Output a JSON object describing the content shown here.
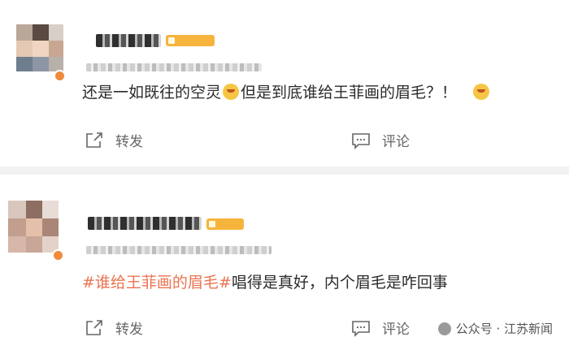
{
  "posts": [
    {
      "text_before_emoji": "还是一如既往的空灵",
      "text_after_emoji": "但是到底谁给王菲画的眉毛？！",
      "emoji_1": "smile-emoji",
      "emoji_2": "tear-emoji",
      "repost_label": "转发",
      "comment_label": "评论"
    },
    {
      "hashtag": "#谁给王菲画的眉毛#",
      "text": "唱得是真好，内个眉毛是咋回事",
      "repost_label": "转发",
      "comment_label": "评论"
    }
  ],
  "watermark": {
    "text": "公众号 · 江苏新闻"
  },
  "colors": {
    "hashtag": "#eb7350",
    "badge": "#f08a3c",
    "divider": "#f2f2f2"
  }
}
